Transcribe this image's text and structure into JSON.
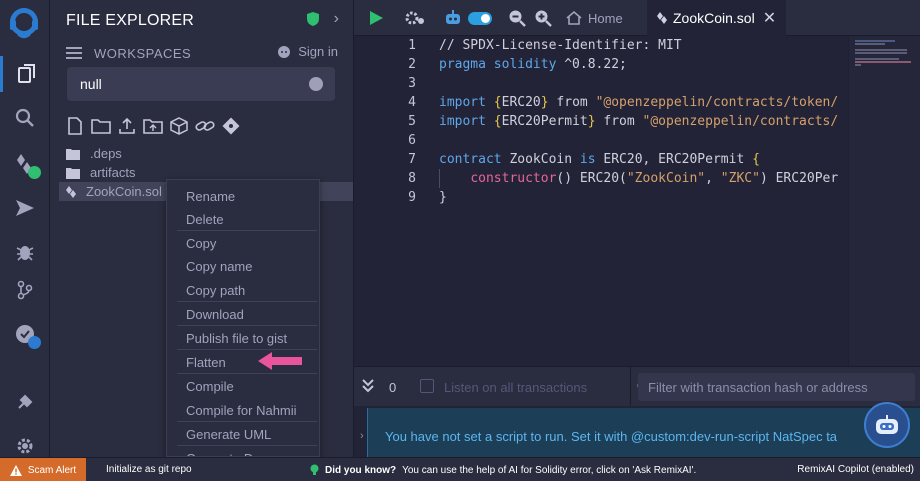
{
  "panel": {
    "title": "FILE EXPLORER",
    "workspaces_label": "WORKSPACES",
    "sign_in": "Sign in",
    "workspace_selected": "null"
  },
  "tree": {
    "items": [
      {
        "name": ".deps",
        "type": "folder"
      },
      {
        "name": "artifacts",
        "type": "folder"
      },
      {
        "name": "ZookCoin.sol",
        "type": "file",
        "selected": true
      }
    ]
  },
  "context_menu": {
    "items": [
      "Rename",
      "Delete",
      "Copy",
      "Copy name",
      "Copy path",
      "Download",
      "Publish file to gist",
      "Flatten",
      "Compile",
      "Compile for Nahmii",
      "Generate UML",
      "Generate Docs"
    ]
  },
  "tabs": {
    "home": "Home",
    "file": "ZookCoin.sol",
    "close": "✕"
  },
  "editor": {
    "line_numbers": [
      "1",
      "2",
      "3",
      "4",
      "5",
      "6",
      "7",
      "8",
      "9"
    ],
    "lines": [
      "// SPDX-License-Identifier: MIT",
      "pragma solidity ^0.8.22;",
      "",
      "import {ERC20} from \"@openzeppelin/contracts/token/",
      "import {ERC20Permit} from \"@openzeppelin/contracts/",
      "",
      "contract ZookCoin is ERC20, ERC20Permit {",
      "    constructor() ERC20(\"ZookCoin\", \"ZKC\") ERC20Per",
      "}"
    ]
  },
  "terminal": {
    "count": "0",
    "listen_label": "Listen on all transactions",
    "filter_placeholder": "Filter with transaction hash or address",
    "message": "You have not set a script to run. Set it with @custom:dev-run-script NatSpec ta"
  },
  "statusbar": {
    "scam_alert": "Scam Alert",
    "git": "Initialize as git repo",
    "did_you_know": "Did you know?",
    "tip": "You can use the help of AI for Solidity error, click on 'Ask RemixAI'.",
    "copilot": "RemixAI Copilot (enabled)"
  },
  "colors": {
    "accent": "#2b7cd1",
    "success": "#2fbf71",
    "scam": "#d56b2a",
    "pointer": "#e8559c"
  },
  "icons": {
    "rail": [
      "remix-logo",
      "file-explorer-icon",
      "search-icon",
      "solidity-compiler-icon",
      "deploy-icon",
      "debugger-icon",
      "git-icon",
      "remixai-icon",
      "plugin-manager-icon",
      "settings-icon"
    ]
  }
}
